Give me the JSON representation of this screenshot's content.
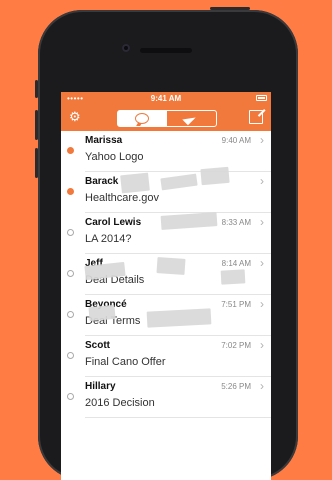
{
  "status_bar": {
    "carrier": "•••••",
    "time": "9:41 AM",
    "battery": "▮"
  },
  "nav": {
    "settings_icon": "gear-icon",
    "compose_icon": "compose-icon",
    "tabs": [
      {
        "icon": "chat-bubble-icon",
        "active": true
      },
      {
        "icon": "send-icon",
        "active": false
      }
    ]
  },
  "colors": {
    "background": "#ff7d45",
    "accent": "#f2793c"
  },
  "messages": [
    {
      "name": "Marissa",
      "subject": "Yahoo Logo",
      "time": "9:40 AM",
      "unread": true
    },
    {
      "name": "Barack",
      "subject": "Healthcare.gov",
      "time": "",
      "unread": true
    },
    {
      "name": "Carol Lewis",
      "subject": "LA 2014?",
      "time": "8:33 AM",
      "unread": false
    },
    {
      "name": "Jeff",
      "subject": "Deal Details",
      "time": "8:14 AM",
      "unread": false
    },
    {
      "name": "Beyoncé",
      "subject": "Deal Terms",
      "time": "7:51 PM",
      "unread": false
    },
    {
      "name": "Scott",
      "subject": "Final Cano Offer",
      "time": "7:02 PM",
      "unread": false
    },
    {
      "name": "Hillary",
      "subject": "2016 Decision",
      "time": "5:26 PM",
      "unread": false
    }
  ]
}
